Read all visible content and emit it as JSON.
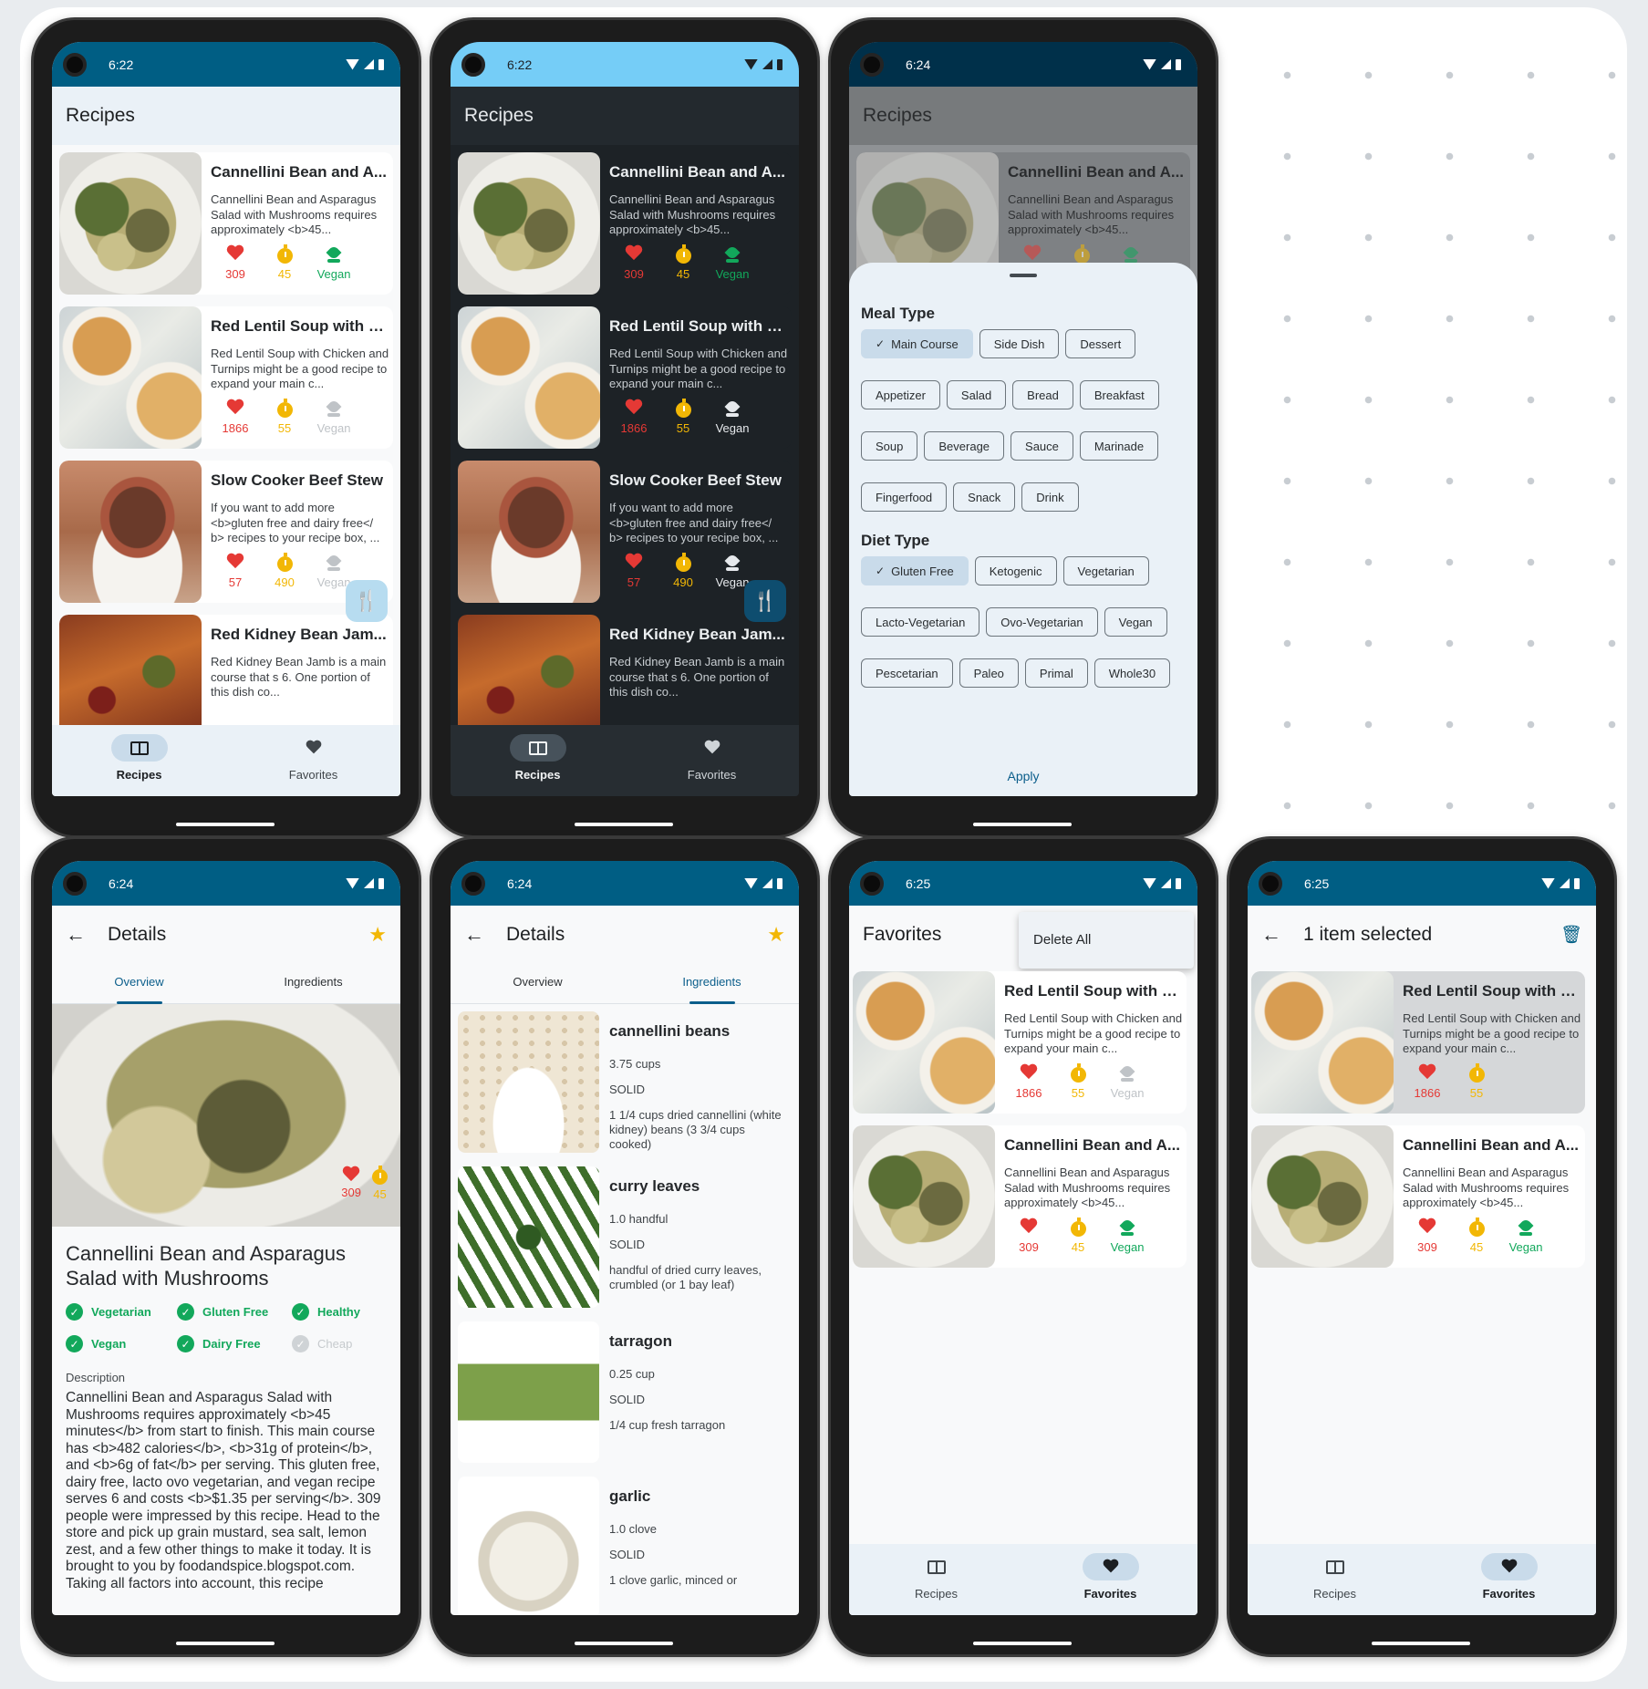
{
  "status": {
    "p1": "6:22",
    "p2": "6:22",
    "p3": "6:24",
    "p4": "6:24",
    "p5": "6:24",
    "p6": "6:25",
    "p7": "6:25"
  },
  "colors": {
    "primary": "#005e84",
    "heart": "#e53935",
    "time": "#f2b705",
    "vegan": "#12a85b",
    "light_status": "#75cdf7"
  },
  "recipes_title": "Recipes",
  "recipes": [
    {
      "title": "Cannellini Bean and A...",
      "desc": "Cannellini Bean and Asparagus Salad with Mushrooms requires approximately <b>45...",
      "likes": "309",
      "minutes": "45",
      "vegan": "Vegan",
      "is_vegan": true
    },
    {
      "title": "Red Lentil Soup with C...",
      "desc": "Red Lentil Soup with Chicken and Turnips might be a good recipe to expand your main c...",
      "likes": "1866",
      "minutes": "55",
      "vegan": "Vegan",
      "is_vegan": false
    },
    {
      "title": "Slow Cooker Beef Stew",
      "desc": "If you want to add more <b>gluten free and dairy free</ b> recipes to your recipe box, ...",
      "likes": "57",
      "minutes": "490",
      "vegan": "Vegan",
      "is_vegan": false
    },
    {
      "title": "Red Kidney Bean Jam...",
      "desc": "Red Kidney Bean Jamb is a main course that s 6. One portion of this dish co...",
      "likes": "",
      "minutes": "",
      "vegan": "",
      "is_vegan": false
    }
  ],
  "nav": {
    "recipes": "Recipes",
    "favorites": "Favorites"
  },
  "fab_icon": "utensils-icon",
  "sheet": {
    "meal_label": "Meal Type",
    "meal_chips": [
      "Main Course",
      "Side Dish",
      "Dessert",
      "Appetizer",
      "Salad",
      "Bread",
      "Breakfast",
      "Soup",
      "Beverage",
      "Sauce",
      "Marinade",
      "Fingerfood",
      "Snack",
      "Drink"
    ],
    "meal_selected": "Main Course",
    "diet_label": "Diet Type",
    "diet_chips": [
      "Gluten Free",
      "Ketogenic",
      "Vegetarian",
      "Lacto-Vegetarian",
      "Ovo-Vegetarian",
      "Vegan",
      "Pescetarian",
      "Paleo",
      "Primal",
      "Whole30"
    ],
    "diet_selected": "Gluten Free",
    "apply": "Apply"
  },
  "details": {
    "title": "Details",
    "tabs": [
      "Overview",
      "Ingredients"
    ],
    "hero_likes": "309",
    "hero_minutes": "45",
    "name": "Cannellini Bean and Asparagus Salad with Mushrooms",
    "badges": [
      {
        "label": "Vegetarian",
        "on": true
      },
      {
        "label": "Gluten Free",
        "on": true
      },
      {
        "label": "Healthy",
        "on": true
      },
      {
        "label": "Vegan",
        "on": true
      },
      {
        "label": "Dairy Free",
        "on": true
      },
      {
        "label": "Cheap",
        "on": false
      }
    ],
    "desc_label": "Description",
    "desc": "Cannellini Bean and Asparagus Salad with Mushrooms requires approximately <b>45 minutes</b> from start to finish. This main course has <b>482 calories</b>, <b>31g of protein</b>, and <b>6g of fat</b> per serving. This gluten free, dairy free, lacto ovo vegetarian, and vegan recipe serves 6 and costs <b>$1.35 per serving</b>. 309 people were impressed by this recipe. Head to the store and pick up grain mustard, sea salt, lemon zest, and a few other things to make it today. It is brought to you by foodandspice.blogspot.com. Taking all factors into account, this recipe"
  },
  "ingredients": [
    {
      "name": "cannellini beans",
      "amount": "3.75  cups",
      "consistency": "SOLID",
      "original": "1 1/4 cups dried cannellini (white kidney) beans (3 3/4 cups cooked)"
    },
    {
      "name": "curry leaves",
      "amount": "1.0  handful",
      "consistency": "SOLID",
      "original": "handful of dried curry leaves, crumbled (or 1 bay leaf)"
    },
    {
      "name": "tarragon",
      "amount": "0.25  cup",
      "consistency": "SOLID",
      "original": "1/4 cup fresh tarragon"
    },
    {
      "name": "garlic",
      "amount": "1.0  clove",
      "consistency": "SOLID",
      "original": "1 clove garlic, minced or"
    }
  ],
  "favorites": {
    "title": "Favorites",
    "menu_item": "Delete All",
    "selected_title": "1 item selected"
  }
}
